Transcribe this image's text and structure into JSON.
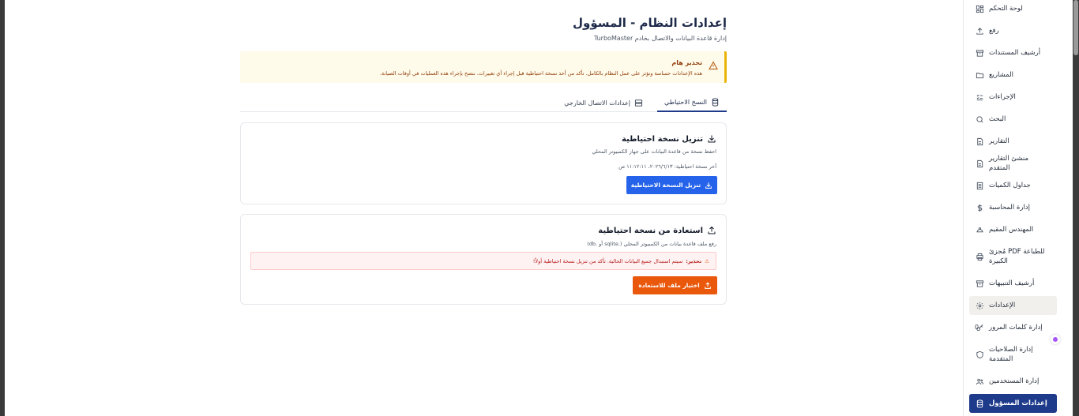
{
  "sidebar": {
    "items": [
      {
        "label": "لوحة التحكم",
        "icon": "dashboard-icon"
      },
      {
        "label": "رفع",
        "icon": "upload-icon"
      },
      {
        "label": "أرشيف المستندات",
        "icon": "archive-icon"
      },
      {
        "label": "المشاريع",
        "icon": "folder-icon"
      },
      {
        "label": "الإجراءات",
        "icon": "checklist-icon"
      },
      {
        "label": "البحث",
        "icon": "search-icon"
      },
      {
        "label": "التقارير",
        "icon": "file-icon"
      },
      {
        "label": "منشئ التقارير المتقدم",
        "icon": "file-icon"
      },
      {
        "label": "جداول الكميات",
        "icon": "table-icon"
      },
      {
        "label": "إدارة المحاسبة",
        "icon": "dollar-icon"
      },
      {
        "label": "المهندس المقيم",
        "icon": "helmet-icon"
      },
      {
        "label": "مُجزئ PDF للطباعة الكبيرة",
        "icon": "printer-icon"
      },
      {
        "label": "أرشيف التنبيهات",
        "icon": "archive-icon"
      },
      {
        "label": "الإعدادات",
        "icon": "gear-icon"
      },
      {
        "label": "إدارة كلمات المرور",
        "icon": "key-icon",
        "badge": "0"
      },
      {
        "label": "إدارة الصلاحيات المتقدمة",
        "icon": "shield-icon"
      },
      {
        "label": "إدارة المستخدمين",
        "icon": "users-icon"
      },
      {
        "label": "إعدادات المسؤول",
        "icon": "database-icon"
      }
    ]
  },
  "page": {
    "title": "إعدادات النظام - المسؤول",
    "subtitle": "إدارة قاعدة البيانات والاتصال بخادم TurboMaster"
  },
  "alert": {
    "title": "تحذير هام",
    "text": "هذه الإعدادات حساسة وتؤثر على عمل النظام بالكامل. تأكد من أخذ نسخة احتياطية قبل إجراء أي تغييرات. ننصح بإجراء هذه العمليات في أوقات الصيانة."
  },
  "tabs": [
    {
      "label": "النسخ الاحتياطي",
      "icon": "database-icon",
      "active": true
    },
    {
      "label": "إعدادات الاتصال الخارجي",
      "icon": "server-icon",
      "active": false
    }
  ],
  "backup_card": {
    "title": "تنزيل نسخة احتياطية",
    "description": "احفظ نسخة من قاعدة البيانات على جهاز الكمبيوتر المحلي",
    "last_backup": "آخر نسخة احتياطية: ٢٠٢٦/٦/١٣، ١١:١٢:١١ ص",
    "button_label": "تنزيل النسخة الاحتياطية"
  },
  "restore_card": {
    "title": "استعادة من نسخة احتياطية",
    "description": "رفع ملف قاعدة بيانات من الكمبيوتر المحلي (.sqlite أو .db)",
    "warning_strong": "تحذير:",
    "warning_text": "سيتم استبدال جميع البيانات الحالية. تأكد من تنزيل نسخة احتياطية أولاً!",
    "button_label": "اختيار ملف للاستعادة"
  },
  "colors": {
    "primary": "#1e3a8a",
    "blue_button": "#2563eb",
    "orange_button": "#ea580c",
    "alert_border": "#eab308"
  }
}
